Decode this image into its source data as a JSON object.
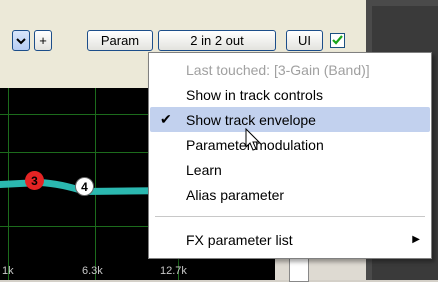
{
  "toolbar": {
    "chevron_icon": "chevron-down-icon",
    "plus_label": "+",
    "param_label": "Param",
    "io_label": "2 in 2 out",
    "ui_label": "UI",
    "enabled_checked": true
  },
  "graph": {
    "freq_labels": [
      "1k",
      "6.3k",
      "12.7k"
    ],
    "nodes": [
      "3",
      "4"
    ]
  },
  "menu": {
    "header": "Last touched: [3-Gain (Band)]",
    "items": [
      {
        "label": "Show in track controls",
        "checked": false
      },
      {
        "label": "Show track envelope",
        "checked": true
      },
      {
        "label": "Parameter modulation",
        "checked": false
      },
      {
        "label": "Learn",
        "checked": false
      },
      {
        "label": "Alias parameter",
        "checked": false
      }
    ],
    "submenu": "FX parameter list"
  },
  "colors": {
    "menu_highlight": "#c2d1ee",
    "graph_line": "#2bb8b0",
    "node3": "#e42424"
  }
}
